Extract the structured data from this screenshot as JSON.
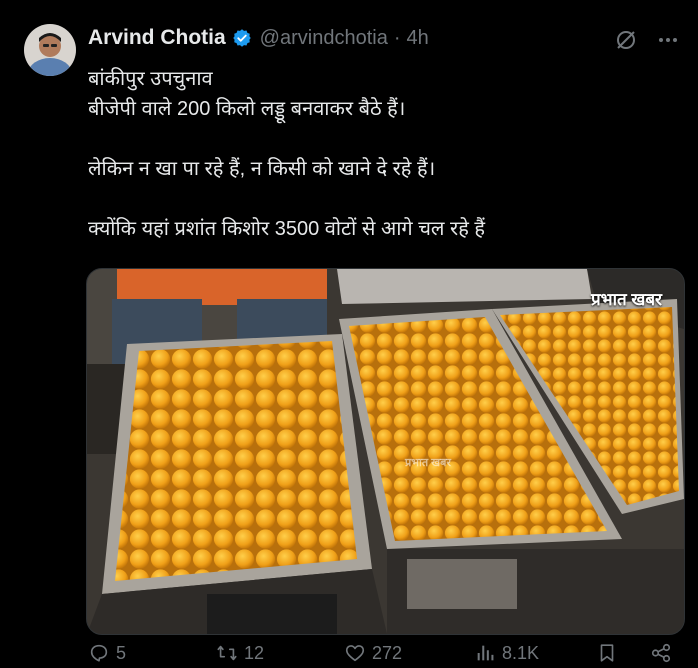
{
  "author": {
    "name": "Arvind Chotia",
    "handle": "@arvindchotia",
    "separator": "·",
    "time": "4h"
  },
  "tweet": {
    "lines": [
      "बांकीपुर उपचुनाव",
      "बीजेपी वाले 200 किलो लड्डू बनवाकर बैठे हैं।",
      "लेकिन न खा पा रहे हैं, न किसी को खाने दे रहे हैं।",
      "क्योंकि यहां प्रशांत किशोर 3500 वोटों से आगे चल रहे हैं"
    ]
  },
  "media": {
    "watermark": "प्रभात खबर",
    "watermark_mid": "प्रभात खबर"
  },
  "actions": {
    "replies": "5",
    "retweets": "12",
    "likes": "272",
    "views": "8.1K"
  },
  "icons": {
    "verified": "verified-badge-icon",
    "grok": "grok-icon",
    "more": "more-icon",
    "reply": "reply-icon",
    "retweet": "retweet-icon",
    "like": "heart-icon",
    "views": "views-icon",
    "share": "share-icon"
  },
  "colors": {
    "background": "#000000",
    "text": "#e7e9ea",
    "muted": "#71767b",
    "verified": "#1d9bf0"
  }
}
